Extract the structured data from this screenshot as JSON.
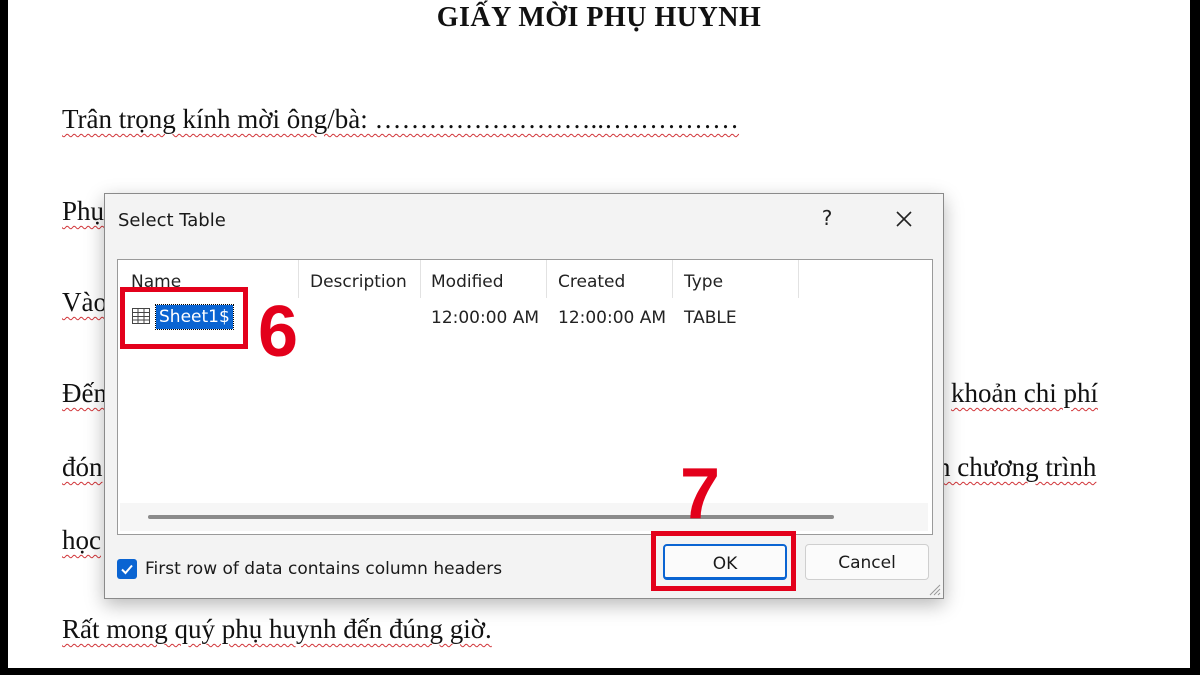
{
  "document": {
    "title": "GIẤY MỜI PHỤ HUYNH",
    "line1": "Trân trọng kính mời ông/bà: ……………………..……………",
    "line2_visible": "Phụ",
    "line3_visible": "Vào",
    "line4_left": "Đến",
    "line4_right": "khoản chi phí",
    "line5_left": "đón",
    "line5_right": "n chương trình",
    "line6_left": "học",
    "line7": "Rất mong quý phụ huynh đến đúng giờ."
  },
  "dialog": {
    "title": "Select Table",
    "help_label": "?",
    "close_icon": "close-icon",
    "columns": [
      "Name",
      "Description",
      "Modified",
      "Created",
      "Type"
    ],
    "rows": [
      {
        "name": "Sheet1$",
        "description": "",
        "modified": "12:00:00 AM",
        "created": "12:00:00 AM",
        "type": "TABLE",
        "icon": "table-icon",
        "selected": true
      }
    ],
    "checkbox": {
      "label": "First row of data contains column headers",
      "checked": true
    },
    "ok_label": "OK",
    "cancel_label": "Cancel"
  },
  "annotations": {
    "step6": "6",
    "step7": "7",
    "highlight_color": "#e3001b"
  },
  "colors": {
    "accent": "#0a64d2",
    "spellcheck": "#d13438"
  }
}
